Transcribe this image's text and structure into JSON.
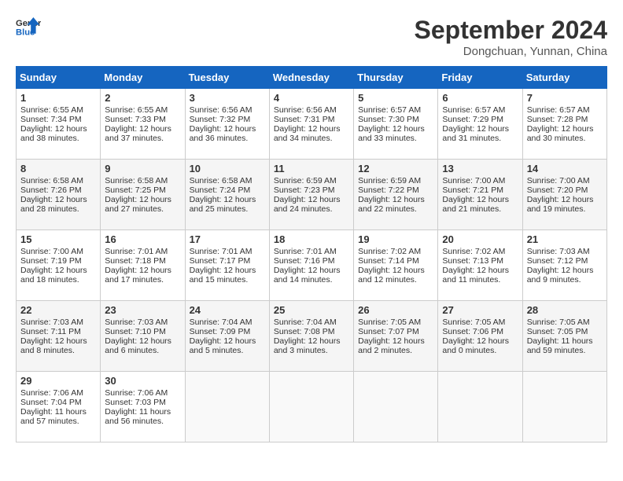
{
  "header": {
    "logo_line1": "General",
    "logo_line2": "Blue",
    "month": "September 2024",
    "location": "Dongchuan, Yunnan, China"
  },
  "weekdays": [
    "Sunday",
    "Monday",
    "Tuesday",
    "Wednesday",
    "Thursday",
    "Friday",
    "Saturday"
  ],
  "weeks": [
    [
      {
        "day": "1",
        "sunrise": "6:55 AM",
        "sunset": "7:34 PM",
        "daylight": "12 hours and 38 minutes."
      },
      {
        "day": "2",
        "sunrise": "6:55 AM",
        "sunset": "7:33 PM",
        "daylight": "12 hours and 37 minutes."
      },
      {
        "day": "3",
        "sunrise": "6:56 AM",
        "sunset": "7:32 PM",
        "daylight": "12 hours and 36 minutes."
      },
      {
        "day": "4",
        "sunrise": "6:56 AM",
        "sunset": "7:31 PM",
        "daylight": "12 hours and 34 minutes."
      },
      {
        "day": "5",
        "sunrise": "6:57 AM",
        "sunset": "7:30 PM",
        "daylight": "12 hours and 33 minutes."
      },
      {
        "day": "6",
        "sunrise": "6:57 AM",
        "sunset": "7:29 PM",
        "daylight": "12 hours and 31 minutes."
      },
      {
        "day": "7",
        "sunrise": "6:57 AM",
        "sunset": "7:28 PM",
        "daylight": "12 hours and 30 minutes."
      }
    ],
    [
      {
        "day": "8",
        "sunrise": "6:58 AM",
        "sunset": "7:26 PM",
        "daylight": "12 hours and 28 minutes."
      },
      {
        "day": "9",
        "sunrise": "6:58 AM",
        "sunset": "7:25 PM",
        "daylight": "12 hours and 27 minutes."
      },
      {
        "day": "10",
        "sunrise": "6:58 AM",
        "sunset": "7:24 PM",
        "daylight": "12 hours and 25 minutes."
      },
      {
        "day": "11",
        "sunrise": "6:59 AM",
        "sunset": "7:23 PM",
        "daylight": "12 hours and 24 minutes."
      },
      {
        "day": "12",
        "sunrise": "6:59 AM",
        "sunset": "7:22 PM",
        "daylight": "12 hours and 22 minutes."
      },
      {
        "day": "13",
        "sunrise": "7:00 AM",
        "sunset": "7:21 PM",
        "daylight": "12 hours and 21 minutes."
      },
      {
        "day": "14",
        "sunrise": "7:00 AM",
        "sunset": "7:20 PM",
        "daylight": "12 hours and 19 minutes."
      }
    ],
    [
      {
        "day": "15",
        "sunrise": "7:00 AM",
        "sunset": "7:19 PM",
        "daylight": "12 hours and 18 minutes."
      },
      {
        "day": "16",
        "sunrise": "7:01 AM",
        "sunset": "7:18 PM",
        "daylight": "12 hours and 17 minutes."
      },
      {
        "day": "17",
        "sunrise": "7:01 AM",
        "sunset": "7:17 PM",
        "daylight": "12 hours and 15 minutes."
      },
      {
        "day": "18",
        "sunrise": "7:01 AM",
        "sunset": "7:16 PM",
        "daylight": "12 hours and 14 minutes."
      },
      {
        "day": "19",
        "sunrise": "7:02 AM",
        "sunset": "7:14 PM",
        "daylight": "12 hours and 12 minutes."
      },
      {
        "day": "20",
        "sunrise": "7:02 AM",
        "sunset": "7:13 PM",
        "daylight": "12 hours and 11 minutes."
      },
      {
        "day": "21",
        "sunrise": "7:03 AM",
        "sunset": "7:12 PM",
        "daylight": "12 hours and 9 minutes."
      }
    ],
    [
      {
        "day": "22",
        "sunrise": "7:03 AM",
        "sunset": "7:11 PM",
        "daylight": "12 hours and 8 minutes."
      },
      {
        "day": "23",
        "sunrise": "7:03 AM",
        "sunset": "7:10 PM",
        "daylight": "12 hours and 6 minutes."
      },
      {
        "day": "24",
        "sunrise": "7:04 AM",
        "sunset": "7:09 PM",
        "daylight": "12 hours and 5 minutes."
      },
      {
        "day": "25",
        "sunrise": "7:04 AM",
        "sunset": "7:08 PM",
        "daylight": "12 hours and 3 minutes."
      },
      {
        "day": "26",
        "sunrise": "7:05 AM",
        "sunset": "7:07 PM",
        "daylight": "12 hours and 2 minutes."
      },
      {
        "day": "27",
        "sunrise": "7:05 AM",
        "sunset": "7:06 PM",
        "daylight": "12 hours and 0 minutes."
      },
      {
        "day": "28",
        "sunrise": "7:05 AM",
        "sunset": "7:05 PM",
        "daylight": "11 hours and 59 minutes."
      }
    ],
    [
      {
        "day": "29",
        "sunrise": "7:06 AM",
        "sunset": "7:04 PM",
        "daylight": "11 hours and 57 minutes."
      },
      {
        "day": "30",
        "sunrise": "7:06 AM",
        "sunset": "7:03 PM",
        "daylight": "11 hours and 56 minutes."
      },
      null,
      null,
      null,
      null,
      null
    ]
  ]
}
